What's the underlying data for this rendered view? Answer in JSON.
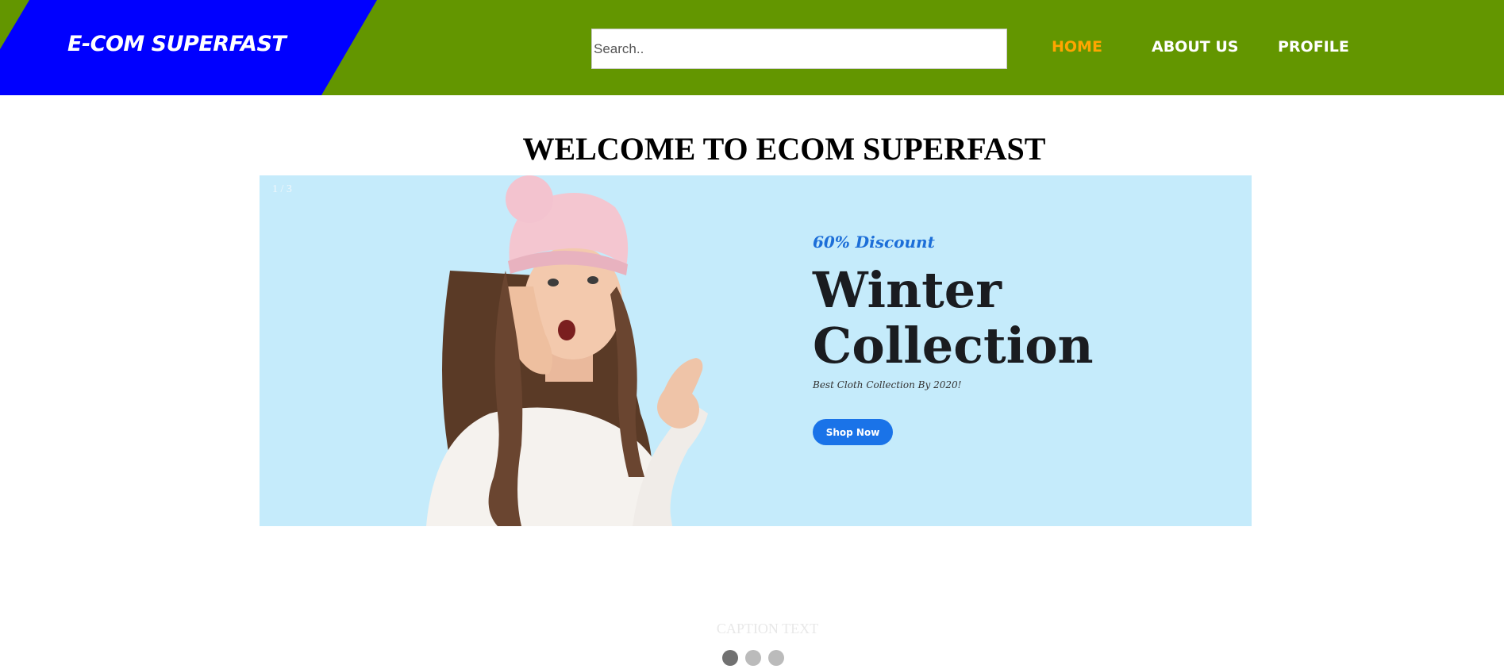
{
  "header": {
    "brand": "E-COM SUPERFAST",
    "search_placeholder": "Search..",
    "nav": [
      {
        "label": "HOME",
        "active": true
      },
      {
        "label": "ABOUT US",
        "active": false
      },
      {
        "label": "PROFILE",
        "active": false
      }
    ]
  },
  "main": {
    "title": "WELCOME TO ECOM SUPERFAST",
    "slideshow": {
      "counter": "1 / 3",
      "caption": "CAPTION TEXT",
      "active_index": 1,
      "total": 3,
      "slide": {
        "discount": "60% Discount",
        "heading_line1": "Winter",
        "heading_line2": "Collection",
        "tagline": "Best Cloth Collection By 2020!",
        "button": "Shop Now"
      }
    }
  },
  "colors": {
    "header_bg": "#639600",
    "brand_bg": "#0000ff",
    "nav_active": "#ffa500",
    "slide_bg": "#c5ebfb",
    "shop_button": "#1a73e8"
  }
}
